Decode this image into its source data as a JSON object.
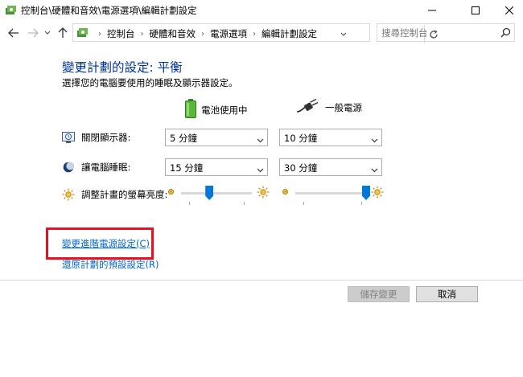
{
  "window": {
    "title": "控制台\\硬體和音效\\電源選項\\編輯計劃設定"
  },
  "navigation": {
    "breadcrumbs": [
      "控制台",
      "硬體和音效",
      "電源選項",
      "編輯計劃設定"
    ],
    "search_placeholder": "搜尋控制台"
  },
  "page": {
    "heading": "變更計劃的設定: 平衡",
    "subheading": "選擇您的電腦要使用的睡眠及顯示器設定。",
    "columns": {
      "battery": "電池使用中",
      "plugged_in": "一般電源"
    },
    "settings": {
      "display_off": {
        "label": "關閉顯示器:",
        "battery_value": "5 分鐘",
        "plugged_value": "10 分鐘"
      },
      "sleep": {
        "label": "讓電腦睡眠:",
        "battery_value": "15 分鐘",
        "plugged_value": "30 分鐘"
      },
      "brightness": {
        "label": "調整計畫的螢幕亮度:",
        "battery_level_percent": 40,
        "plugged_level_percent": 100
      }
    },
    "links": {
      "advanced": "變更進階電源設定(C)",
      "restore": "還原計劃的預設設定(R)"
    },
    "buttons": {
      "save": "儲存變更",
      "cancel": "取消"
    }
  },
  "colors": {
    "accent": "#0078d7",
    "heading": "#003399",
    "link": "#0066cc",
    "highlight": "#e81123"
  }
}
